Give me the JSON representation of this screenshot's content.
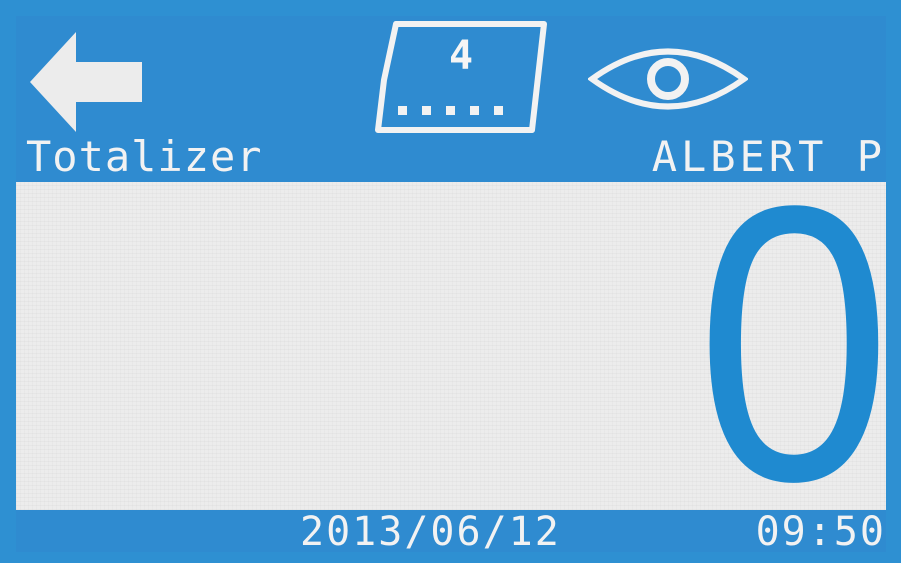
{
  "header": {
    "back_icon": "arrow-left-icon",
    "sheet": {
      "icon": "ticket-sheet-icon",
      "number": "4"
    },
    "view_icon": "eye-icon",
    "title": "Totalizer",
    "user": "ALBERT P"
  },
  "display": {
    "value": "0"
  },
  "footer": {
    "date": "2013/06/12",
    "time": "09:50"
  },
  "colors": {
    "background": "#2e90d2",
    "panel": "#ececec",
    "value": "#1f8ad0",
    "text": "#f2f2f2"
  }
}
